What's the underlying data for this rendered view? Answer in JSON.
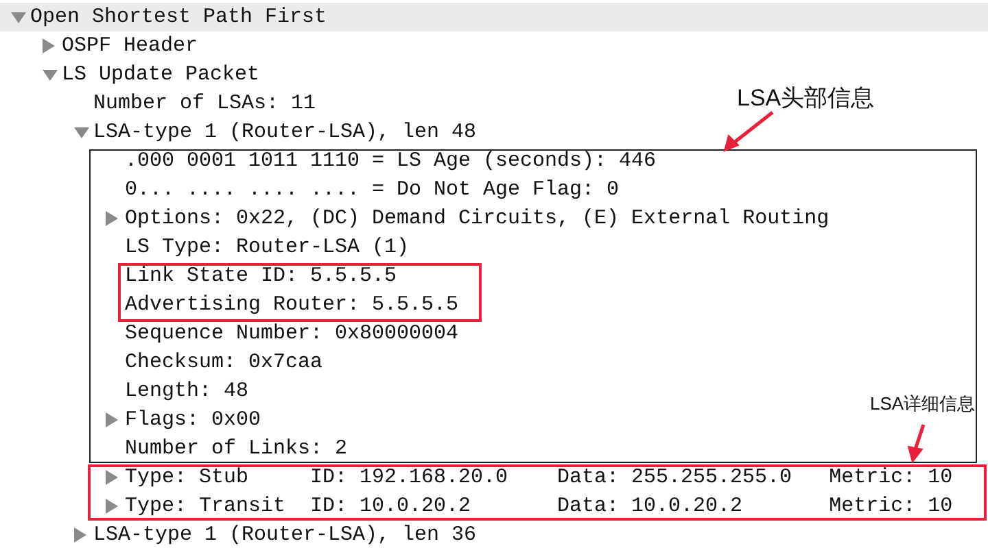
{
  "tree": [
    {
      "text": "Open Shortest Path First",
      "expanded": true,
      "selected": true,
      "children": [
        {
          "text": "OSPF Header",
          "expanded": false,
          "selected": false
        },
        {
          "text": "LS Update Packet",
          "expanded": true,
          "selected": false,
          "children": [
            {
              "text": "Number of LSAs: 11",
              "selected": false
            },
            {
              "text": "LSA-type 1 (Router-LSA), len 48",
              "expanded": true,
              "selected": false,
              "children": [
                {
                  "text": ".000 0001 1011 1110 = LS Age (seconds): 446",
                  "selected": false
                },
                {
                  "text": "0... .... .... .... = Do Not Age Flag: 0",
                  "selected": false
                },
                {
                  "text": "Options: 0x22, (DC) Demand Circuits, (E) External Routing",
                  "expanded": false,
                  "selected": false
                },
                {
                  "text": "LS Type: Router-LSA (1)",
                  "selected": false
                },
                {
                  "text": "Link State ID: 5.5.5.5",
                  "selected": false
                },
                {
                  "text": "Advertising Router: 5.5.5.5",
                  "selected": false
                },
                {
                  "text": "Sequence Number: 0x80000004",
                  "selected": false
                },
                {
                  "text": "Checksum: 0x7caa",
                  "selected": false
                },
                {
                  "text": "Length: 48",
                  "selected": false
                },
                {
                  "text": "Flags: 0x00",
                  "expanded": false,
                  "selected": false
                },
                {
                  "text": "Number of Links: 2",
                  "selected": false
                },
                {
                  "kind": "link",
                  "columns": [
                    "Type: Stub",
                    "ID: 192.168.20.0",
                    "Data: 255.255.255.0",
                    "Metric: 10"
                  ],
                  "expanded": false,
                  "selected": false
                },
                {
                  "kind": "link",
                  "columns": [
                    "Type: Transit",
                    "ID: 10.0.20.2",
                    "Data: 10.0.20.2",
                    "Metric: 10"
                  ],
                  "expanded": false,
                  "selected": false
                }
              ]
            },
            {
              "text": "LSA-type 1 (Router-LSA), len 36",
              "expanded": false,
              "selected": false
            }
          ]
        }
      ]
    }
  ],
  "annotations": [
    {
      "kind": "header",
      "label": "LSA头部信息"
    },
    {
      "kind": "detail",
      "label": "LSA详细信息"
    }
  ]
}
